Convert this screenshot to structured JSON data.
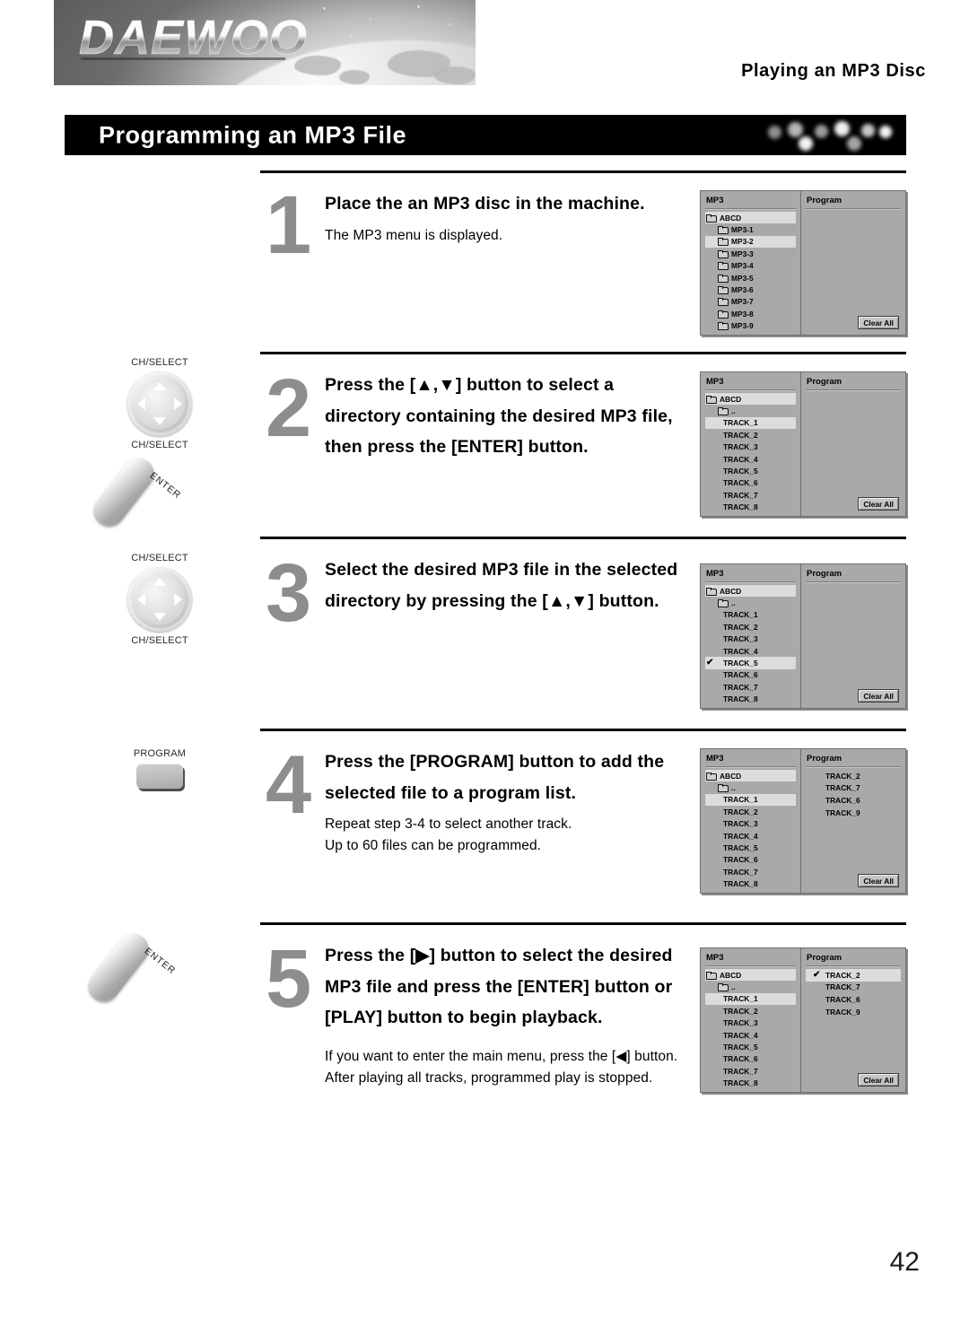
{
  "header": {
    "brand_logo": "DAEWOO",
    "section_label": "Playing an MP3 Disc",
    "title": "Programming an MP3 File"
  },
  "page_number": "42",
  "colors": {
    "title_bar_bg": "#000000",
    "title_text": "#ffffff",
    "step_number": "#8d8d8d",
    "osd_bg": "#a9a9a9",
    "osd_highlight": "#dcdcdc"
  },
  "steps": [
    {
      "number": "1",
      "heading": "Place the an MP3 disc in the machine.",
      "sub_lines": [
        "The MP3 menu is displayed."
      ],
      "remote": null
    },
    {
      "number": "2",
      "heading": "Press the [▲,▼] button to select a directory containing the desired MP3 file, then press the [ENTER] button.",
      "sub_lines": [],
      "remote": {
        "type": "dpad-enter",
        "label_top": "CH/SELECT",
        "label_bottom": "CH/SELECT",
        "enter_label": "ENTER"
      }
    },
    {
      "number": "3",
      "heading": "Select the desired MP3 file in the selected directory by pressing the [▲,▼] button.",
      "sub_lines": [],
      "remote": {
        "type": "dpad",
        "label_top": "CH/SELECT",
        "label_bottom": "CH/SELECT"
      }
    },
    {
      "number": "4",
      "heading": "Press the [PROGRAM] button to add the selected file to a program list.",
      "sub_lines": [
        "Repeat step 3-4 to select another track.",
        "Up to 60 files can be programmed."
      ],
      "remote": {
        "type": "program",
        "label_top": "PROGRAM"
      }
    },
    {
      "number": "5",
      "heading": "Press the [▶] button to select the desired MP3 file and press the [ENTER] button or [PLAY] button to begin playback.",
      "sub_lines": [
        "If you want to enter the main menu, press the [◀] button.",
        "After playing all tracks, programmed play is stopped."
      ],
      "remote": {
        "type": "enter",
        "enter_label": "ENTER"
      }
    }
  ],
  "screens": [
    {
      "left_title": "MP3",
      "right_title": "Program",
      "clear_all_label": "Clear All",
      "left_items": [
        {
          "label": "ABCD",
          "folder": true,
          "indent": 0,
          "selected": true,
          "checked": false
        },
        {
          "label": "MP3-1",
          "folder": true,
          "indent": 1,
          "selected": false,
          "checked": false
        },
        {
          "label": "MP3-2",
          "folder": true,
          "indent": 1,
          "selected": true,
          "checked": false
        },
        {
          "label": "MP3-3",
          "folder": true,
          "indent": 1,
          "selected": false,
          "checked": false
        },
        {
          "label": "MP3-4",
          "folder": true,
          "indent": 1,
          "selected": false,
          "checked": false
        },
        {
          "label": "MP3-5",
          "folder": true,
          "indent": 1,
          "selected": false,
          "checked": false
        },
        {
          "label": "MP3-6",
          "folder": true,
          "indent": 1,
          "selected": false,
          "checked": false
        },
        {
          "label": "MP3-7",
          "folder": true,
          "indent": 1,
          "selected": false,
          "checked": false
        },
        {
          "label": "MP3-8",
          "folder": true,
          "indent": 1,
          "selected": false,
          "checked": false
        },
        {
          "label": "MP3-9",
          "folder": true,
          "indent": 1,
          "selected": false,
          "checked": false
        }
      ],
      "program_items": []
    },
    {
      "left_title": "MP3",
      "right_title": "Program",
      "clear_all_label": "Clear All",
      "left_items": [
        {
          "label": "ABCD",
          "folder": true,
          "indent": 0,
          "selected": true,
          "checked": false
        },
        {
          "label": "..",
          "folder": true,
          "indent": 1,
          "selected": false,
          "checked": false
        },
        {
          "label": "TRACK_1",
          "folder": false,
          "indent": 2,
          "selected": true,
          "checked": false
        },
        {
          "label": "TRACK_2",
          "folder": false,
          "indent": 2,
          "selected": false,
          "checked": false
        },
        {
          "label": "TRACK_3",
          "folder": false,
          "indent": 2,
          "selected": false,
          "checked": false
        },
        {
          "label": "TRACK_4",
          "folder": false,
          "indent": 2,
          "selected": false,
          "checked": false
        },
        {
          "label": "TRACK_5",
          "folder": false,
          "indent": 2,
          "selected": false,
          "checked": false
        },
        {
          "label": "TRACK_6",
          "folder": false,
          "indent": 2,
          "selected": false,
          "checked": false
        },
        {
          "label": "TRACK_7",
          "folder": false,
          "indent": 2,
          "selected": false,
          "checked": false
        },
        {
          "label": "TRACK_8",
          "folder": false,
          "indent": 2,
          "selected": false,
          "checked": false
        }
      ],
      "program_items": []
    },
    {
      "left_title": "MP3",
      "right_title": "Program",
      "clear_all_label": "Clear All",
      "left_items": [
        {
          "label": "ABCD",
          "folder": true,
          "indent": 0,
          "selected": true,
          "checked": false
        },
        {
          "label": "..",
          "folder": true,
          "indent": 1,
          "selected": false,
          "checked": false
        },
        {
          "label": "TRACK_1",
          "folder": false,
          "indent": 2,
          "selected": false,
          "checked": false
        },
        {
          "label": "TRACK_2",
          "folder": false,
          "indent": 2,
          "selected": false,
          "checked": false
        },
        {
          "label": "TRACK_3",
          "folder": false,
          "indent": 2,
          "selected": false,
          "checked": false
        },
        {
          "label": "TRACK_4",
          "folder": false,
          "indent": 2,
          "selected": false,
          "checked": false
        },
        {
          "label": "TRACK_5",
          "folder": false,
          "indent": 2,
          "selected": true,
          "checked": true
        },
        {
          "label": "TRACK_6",
          "folder": false,
          "indent": 2,
          "selected": false,
          "checked": false
        },
        {
          "label": "TRACK_7",
          "folder": false,
          "indent": 2,
          "selected": false,
          "checked": false
        },
        {
          "label": "TRACK_8",
          "folder": false,
          "indent": 2,
          "selected": false,
          "checked": false
        }
      ],
      "program_items": []
    },
    {
      "left_title": "MP3",
      "right_title": "Program",
      "clear_all_label": "Clear All",
      "left_items": [
        {
          "label": "ABCD",
          "folder": true,
          "indent": 0,
          "selected": true,
          "checked": false
        },
        {
          "label": "..",
          "folder": true,
          "indent": 1,
          "selected": false,
          "checked": false
        },
        {
          "label": "TRACK_1",
          "folder": false,
          "indent": 2,
          "selected": true,
          "checked": false
        },
        {
          "label": "TRACK_2",
          "folder": false,
          "indent": 2,
          "selected": false,
          "checked": false
        },
        {
          "label": "TRACK_3",
          "folder": false,
          "indent": 2,
          "selected": false,
          "checked": false
        },
        {
          "label": "TRACK_4",
          "folder": false,
          "indent": 2,
          "selected": false,
          "checked": false
        },
        {
          "label": "TRACK_5",
          "folder": false,
          "indent": 2,
          "selected": false,
          "checked": false
        },
        {
          "label": "TRACK_6",
          "folder": false,
          "indent": 2,
          "selected": false,
          "checked": false
        },
        {
          "label": "TRACK_7",
          "folder": false,
          "indent": 2,
          "selected": false,
          "checked": false
        },
        {
          "label": "TRACK_8",
          "folder": false,
          "indent": 2,
          "selected": false,
          "checked": false
        }
      ],
      "program_items": [
        {
          "label": "TRACK_2",
          "selected": false,
          "checked": false
        },
        {
          "label": "TRACK_7",
          "selected": false,
          "checked": false
        },
        {
          "label": "TRACK_6",
          "selected": false,
          "checked": false
        },
        {
          "label": "TRACK_9",
          "selected": false,
          "checked": false
        }
      ]
    },
    {
      "left_title": "MP3",
      "right_title": "Program",
      "clear_all_label": "Clear All",
      "left_items": [
        {
          "label": "ABCD",
          "folder": true,
          "indent": 0,
          "selected": true,
          "checked": false
        },
        {
          "label": "..",
          "folder": true,
          "indent": 1,
          "selected": false,
          "checked": false
        },
        {
          "label": "TRACK_1",
          "folder": false,
          "indent": 2,
          "selected": true,
          "checked": false
        },
        {
          "label": "TRACK_2",
          "folder": false,
          "indent": 2,
          "selected": false,
          "checked": false
        },
        {
          "label": "TRACK_3",
          "folder": false,
          "indent": 2,
          "selected": false,
          "checked": false
        },
        {
          "label": "TRACK_4",
          "folder": false,
          "indent": 2,
          "selected": false,
          "checked": false
        },
        {
          "label": "TRACK_5",
          "folder": false,
          "indent": 2,
          "selected": false,
          "checked": false
        },
        {
          "label": "TRACK_6",
          "folder": false,
          "indent": 2,
          "selected": false,
          "checked": false
        },
        {
          "label": "TRACK_7",
          "folder": false,
          "indent": 2,
          "selected": false,
          "checked": false
        },
        {
          "label": "TRACK_8",
          "folder": false,
          "indent": 2,
          "selected": false,
          "checked": false
        }
      ],
      "program_items": [
        {
          "label": "TRACK_2",
          "selected": true,
          "checked": true
        },
        {
          "label": "TRACK_7",
          "selected": false,
          "checked": false
        },
        {
          "label": "TRACK_6",
          "selected": false,
          "checked": false
        },
        {
          "label": "TRACK_9",
          "selected": false,
          "checked": false
        }
      ]
    }
  ]
}
